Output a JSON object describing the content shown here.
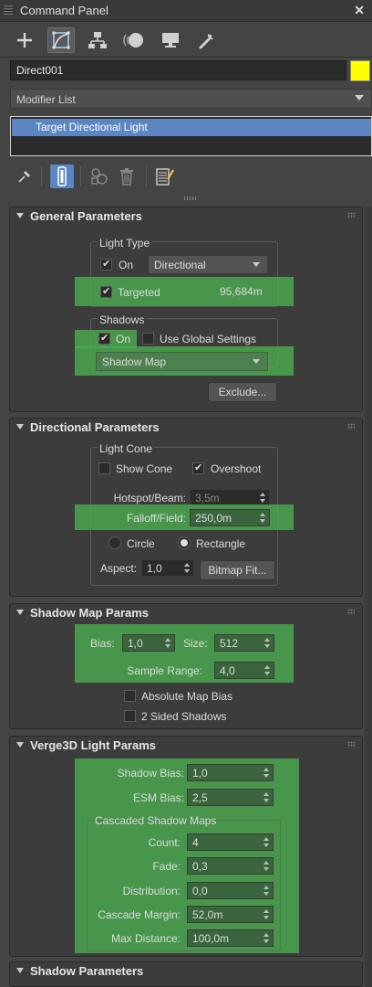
{
  "window": {
    "title": "Command Panel"
  },
  "tabs": [
    {
      "icon": "create-plus-icon"
    },
    {
      "icon": "modify-icon",
      "active": true
    },
    {
      "icon": "hierarchy-icon"
    },
    {
      "icon": "motion-icon"
    },
    {
      "icon": "display-icon"
    },
    {
      "icon": "utilities-wrench-icon"
    }
  ],
  "object": {
    "name": "Direct001",
    "color": "#ffff00"
  },
  "modifier_list": {
    "label": "Modifier List"
  },
  "stack": {
    "selected_item": "Target Directional Light"
  },
  "general": {
    "title": "General Parameters",
    "light_type_label": "Light Type",
    "on_label": "On",
    "type_value": "Directional",
    "targeted_label": "Targeted",
    "targeted_distance": "95,684m",
    "shadows_label": "Shadows",
    "shadows_on_label": "On",
    "use_global_label": "Use Global Settings",
    "shadow_type": "Shadow Map",
    "exclude_label": "Exclude..."
  },
  "directional": {
    "title": "Directional Parameters",
    "light_cone_label": "Light Cone",
    "show_cone_label": "Show Cone",
    "overshoot_label": "Overshoot",
    "hotspot_label": "Hotspot/Beam:",
    "hotspot_value": "3,5m",
    "falloff_label": "Falloff/Field:",
    "falloff_value": "250,0m",
    "circle_label": "Circle",
    "rectangle_label": "Rectangle",
    "aspect_label": "Aspect:",
    "aspect_value": "1,0",
    "bitmap_fit_label": "Bitmap Fit..."
  },
  "shadowmap": {
    "title": "Shadow Map Params",
    "bias_label": "Bias:",
    "bias_value": "1,0",
    "size_label": "Size:",
    "size_value": "512",
    "sample_range_label": "Sample Range:",
    "sample_range_value": "4,0",
    "absolute_bias_label": "Absolute Map Bias",
    "two_sided_label": "2 Sided Shadows"
  },
  "verge": {
    "title": "Verge3D Light Params",
    "shadow_bias_label": "Shadow Bias:",
    "shadow_bias_value": "1,0",
    "esm_bias_label": "ESM Bias:",
    "esm_bias_value": "2,5",
    "csm_label": "Cascaded Shadow Maps",
    "count_label": "Count:",
    "count_value": "4",
    "fade_label": "Fade:",
    "fade_value": "0,3",
    "distribution_label": "Distribution:",
    "distribution_value": "0,0",
    "cascade_margin_label": "Cascade Margin:",
    "cascade_margin_value": "52,0m",
    "max_distance_label": "Max Distance:",
    "max_distance_value": "100,0m"
  },
  "next_rollout": {
    "title": "Shadow Parameters"
  }
}
